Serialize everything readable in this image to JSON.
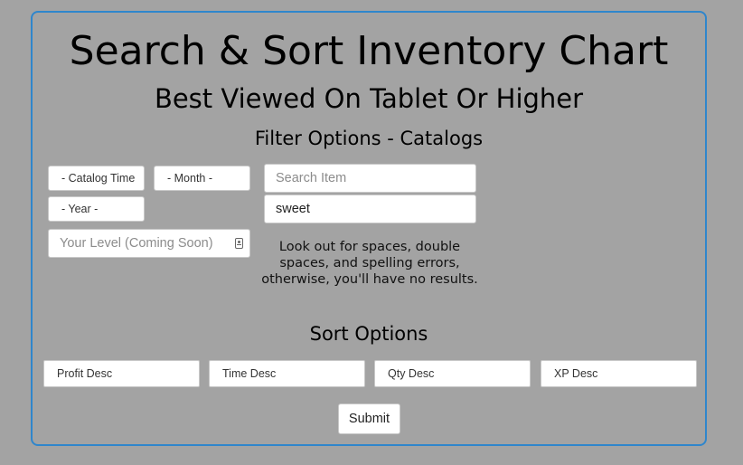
{
  "header": {
    "title": "Search & Sort Inventory Chart",
    "subtitle": "Best Viewed On Tablet Or Higher"
  },
  "filter": {
    "heading": "Filter Options - Catalogs",
    "catalog_time": "- Catalog Time",
    "month": "- Month -",
    "year": "- Year -",
    "level_placeholder": "Your Level (Coming Soon)",
    "level_icon": "contact-card-icon",
    "search_placeholder": "Search Item",
    "search_value": "sweet",
    "note": "Look out for spaces, double spaces, and spelling errors, otherwise, you'll have no results."
  },
  "sort": {
    "heading": "Sort Options",
    "options": [
      "Profit Desc",
      "Time Desc",
      "Qty Desc",
      "XP Desc"
    ]
  },
  "submit_label": "Submit",
  "colors": {
    "background": "#a3a3a3",
    "panel_border": "#2f86cc"
  }
}
